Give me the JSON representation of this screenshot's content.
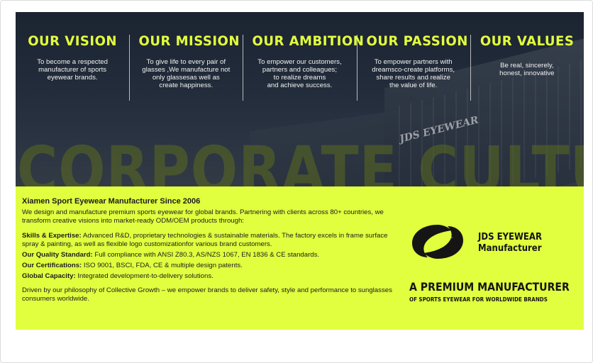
{
  "watermark": "CORPORATE CULTURE",
  "building_sign": "JDS EYEWEAR",
  "columns": [
    {
      "title": "OUR VISION",
      "text": "To become a respected\nmanufacturer of sports\neyewear brands."
    },
    {
      "title": "OUR MISSION",
      "text": "To give life to every pair of\nglasses ,We manufacture not\nonly glassesas well as\ncreate happiness."
    },
    {
      "title": "OUR AMBITION",
      "text": "To empower our customers,\npartners and colleagues;\nto realize dreams\nand achieve success."
    },
    {
      "title": "OUR PASSION",
      "text": "To empower partners with\ndreamsco-create platforms,\nshare results and realize\nthe value of life."
    },
    {
      "title": "OUR VALUES",
      "text": "Be real, sincerely,\nhonest, innovative"
    }
  ],
  "info": {
    "heading": "Xiamen Sport Eyewear Manufacturer Since 2006",
    "intro": "We design and manufacture premium sports eyewear for global brands. Partnering with clients across 80+ countries, we transform creative visions into market-ready ODM/OEM products through:",
    "skills_label": "Skills & Expertise:",
    "skills_text": " Advanced R&D, proprietary technologies & sustainable materials. The factory excels in frame surface spray & painting, as well as flexible logo customizationfor various brand customers.",
    "quality_label": "Our Quality Standard:",
    "quality_text": " Full compliance with ANSI Z80.3, AS/NZS 1067, EN 1836 & CE standards.",
    "cert_label": "Our Certifications:",
    "cert_text": "  ISO 9001, BSCI, FDA, CE & multiple design patents.",
    "capacity_label": "Global Capacity:",
    "capacity_text": "  Integrated development-to-delivery solutions.",
    "closing": "Driven by our philosophy of Collective Growth – we empower brands to deliver safety, style and performance to sunglasses consumers worldwide."
  },
  "brand": {
    "line1": "JDS EYEWEAR",
    "line2": "Manufacturer",
    "tagline": "A PREMIUM MANUFACTURER",
    "subtagline": "OF SPORTS EYEWEAR FOR WORLDWIDE BRANDS"
  },
  "colors": {
    "accent": "#e1ff3f",
    "title": "#e3ff3d",
    "dark": "#1c2431"
  }
}
